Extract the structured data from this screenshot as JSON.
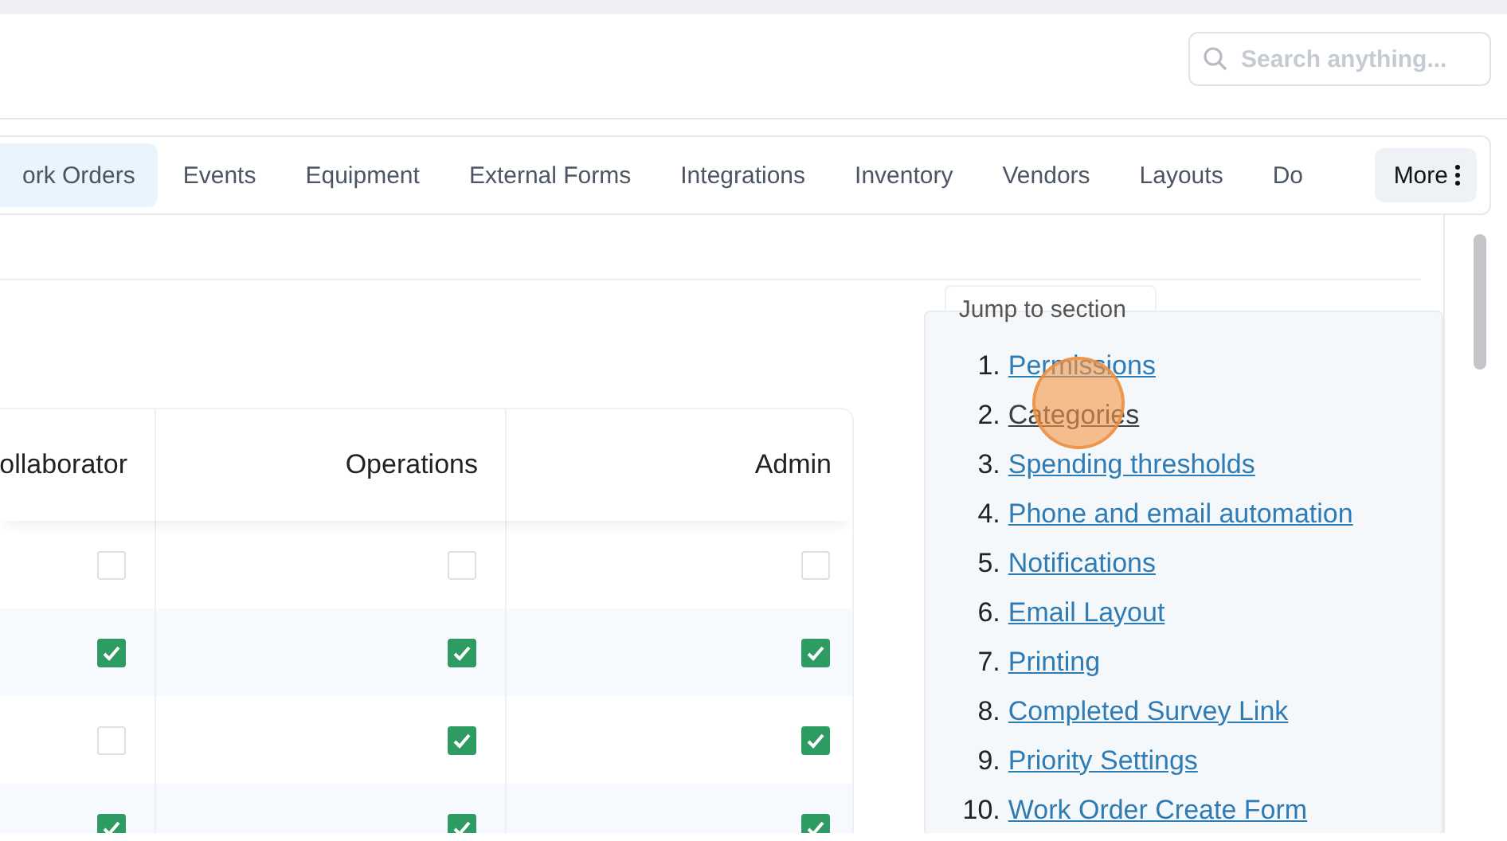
{
  "search": {
    "placeholder": "Search anything..."
  },
  "tabs": [
    {
      "label": "ork Orders",
      "selected": true
    },
    {
      "label": "Events",
      "selected": false
    },
    {
      "label": "Equipment",
      "selected": false
    },
    {
      "label": "External Forms",
      "selected": false
    },
    {
      "label": "Integrations",
      "selected": false
    },
    {
      "label": "Inventory",
      "selected": false
    },
    {
      "label": "Vendors",
      "selected": false
    },
    {
      "label": "Layouts",
      "selected": false
    },
    {
      "label": "Do",
      "selected": false
    }
  ],
  "more_button": {
    "label": "More"
  },
  "table": {
    "columns": [
      "ollaborator",
      "Operations",
      "Admin"
    ],
    "rows": [
      {
        "checked": [
          false,
          false,
          false
        ]
      },
      {
        "checked": [
          true,
          true,
          true
        ]
      },
      {
        "checked": [
          false,
          true,
          true
        ]
      },
      {
        "checked": [
          true,
          true,
          true
        ]
      }
    ]
  },
  "jump_to_section": {
    "title": "Jump to section",
    "items": [
      {
        "number": "1.",
        "label": "Permissions",
        "hovered": false
      },
      {
        "number": "2.",
        "label": "Categories",
        "hovered": true
      },
      {
        "number": "3.",
        "label": "Spending thresholds",
        "hovered": false
      },
      {
        "number": "4.",
        "label": "Phone and email automation",
        "hovered": false
      },
      {
        "number": "5.",
        "label": "Notifications",
        "hovered": false
      },
      {
        "number": "6.",
        "label": "Email Layout",
        "hovered": false
      },
      {
        "number": "7.",
        "label": "Printing",
        "hovered": false
      },
      {
        "number": "8.",
        "label": "Completed Survey Link",
        "hovered": false
      },
      {
        "number": "9.",
        "label": "Priority Settings",
        "hovered": false
      },
      {
        "number": "10.",
        "label": "Work Order Create Form",
        "hovered": false
      }
    ]
  }
}
